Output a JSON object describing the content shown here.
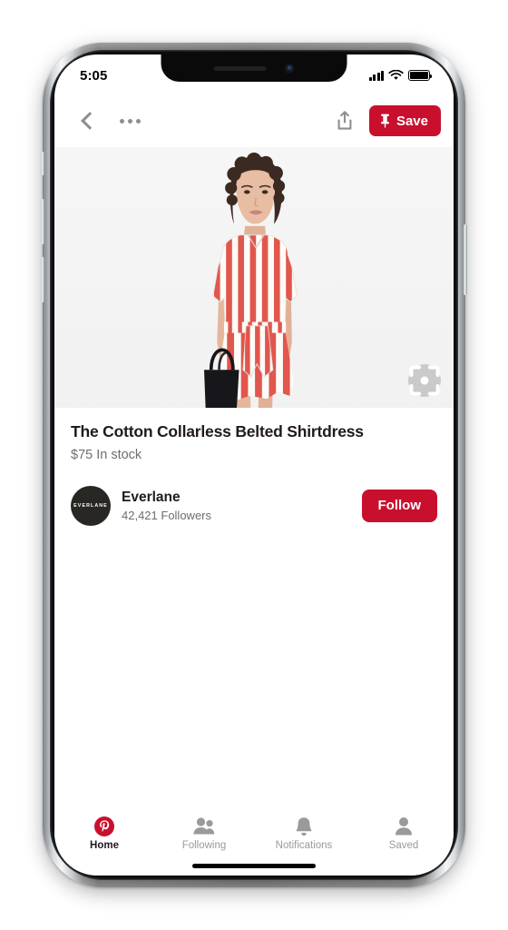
{
  "device": {
    "name": "iphone-x-mockup"
  },
  "status_bar": {
    "time": "5:05",
    "signal_icon": "cellular-signal-icon",
    "wifi_icon": "wifi-icon",
    "battery_icon": "battery-full-icon"
  },
  "nav_bar": {
    "back_icon": "back-chevron-icon",
    "more_icon": "more-options-icon",
    "share_icon": "share-icon",
    "save_label": "Save",
    "save_icon": "pushpin-icon",
    "save_color": "#c8102e"
  },
  "hero": {
    "alt": "Model wearing red and white striped belted shirtdress holding a black tote bag",
    "background": "#f4f4f4",
    "stripe_color": "#e1564d",
    "lens_icon": "visual-search-lens-icon"
  },
  "product": {
    "title": "The Cotton Collarless Belted Shirtdress",
    "price": "$75",
    "availability": "In stock",
    "price_line": "$75 In stock"
  },
  "brand": {
    "avatar_text": "EVERLANE",
    "avatar_color": "#292724",
    "name": "Everlane",
    "followers": "42,421 Followers",
    "follow_label": "Follow",
    "follow_color": "#c8102e"
  },
  "tab_bar": {
    "items": [
      {
        "label": "Home",
        "icon": "pinterest-logo-icon",
        "active": true
      },
      {
        "label": "Following",
        "icon": "people-icon",
        "active": false
      },
      {
        "label": "Notifications",
        "icon": "bell-icon",
        "active": false
      },
      {
        "label": "Saved",
        "icon": "person-icon",
        "active": false
      }
    ]
  }
}
